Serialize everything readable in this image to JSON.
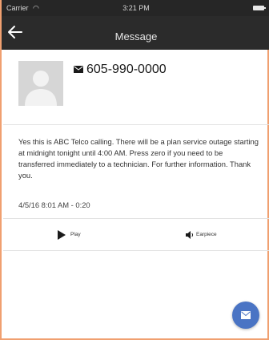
{
  "status_bar": {
    "carrier": "Carrier",
    "time": "3:21 PM",
    "wifi_icon": "wifi-icon",
    "battery_icon": "battery-icon"
  },
  "nav": {
    "back_icon": "back-arrow-icon",
    "title": "Message"
  },
  "contact": {
    "avatar_icon": "avatar-placeholder-icon",
    "message_type_icon": "envelope-icon",
    "phone_number": "605-990-0000"
  },
  "message": {
    "body": "Yes this is ABC Telco calling. There will be a plan service outage starting at midnight tonight until 4:00 AM. Press zero if you need to be transferred immediately to a technician. For further information. Thank you.",
    "timestamp": "4/5/16 8:01 AM - 0:20"
  },
  "actions": {
    "play_label": "Play",
    "play_icon": "play-icon",
    "earpiece_label": "Earpiece",
    "earpiece_icon": "speaker-icon"
  },
  "fab": {
    "icon": "envelope-icon",
    "color": "#4a74c4"
  },
  "colors": {
    "nav_background": "#2b2b2b",
    "frame_accent": "#f0a070"
  }
}
